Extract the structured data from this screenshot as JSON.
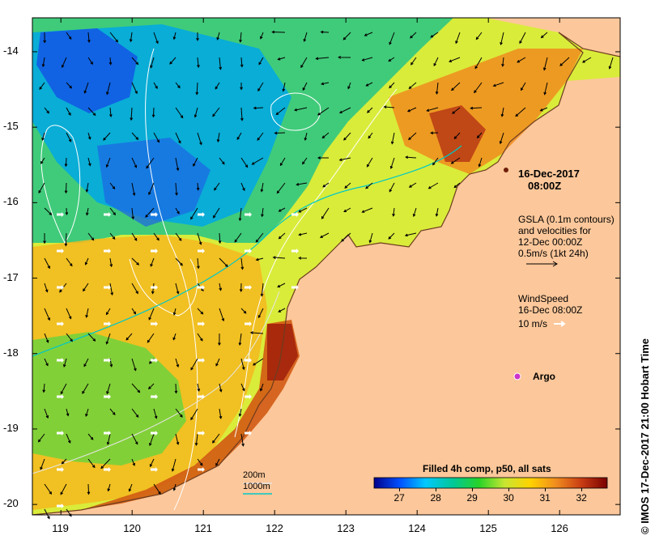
{
  "map": {
    "x_ticks": [
      "119",
      "120",
      "121",
      "122",
      "123",
      "124",
      "125",
      "126"
    ],
    "y_ticks": [
      "-14",
      "-15",
      "-16",
      "-17",
      "-18",
      "-19",
      "-20"
    ]
  },
  "annotations": {
    "date": "16-Dec-2017",
    "time": "08:00Z",
    "gsla_line1": "GSLA (0.1m contours)",
    "gsla_line2": "and velocities for",
    "gsla_line3": "12-Dec 00:00Z",
    "gsla_line4": "0.5m/s (1kt 24h)",
    "wind_line1": "WindSpeed",
    "wind_line2": "16-Dec 08:00Z",
    "wind_scale": "10 m/s",
    "argo_label": "Argo",
    "depth_200": "200m",
    "depth_1000": "1000m"
  },
  "colorbar": {
    "title": "Filled 4h comp, p50, all sats",
    "ticks": [
      "27",
      "28",
      "29",
      "30",
      "31",
      "32"
    ],
    "range": [
      26.3,
      32.7
    ],
    "colors": [
      "#00008b",
      "#0050ff",
      "#00c8ff",
      "#00c896",
      "#28d228",
      "#c8e632",
      "#ffd200",
      "#f08c1e",
      "#c83c14",
      "#780000"
    ]
  },
  "credit": "© IMOS 17-Dec-2017 21:00 Hobart Time",
  "colors": {
    "land": "#fcc79a",
    "contour": "#ffffff",
    "isobath_200": "#e6e6e6",
    "isobath_1000": "#00c8c8",
    "argo": "#cc33cc"
  }
}
